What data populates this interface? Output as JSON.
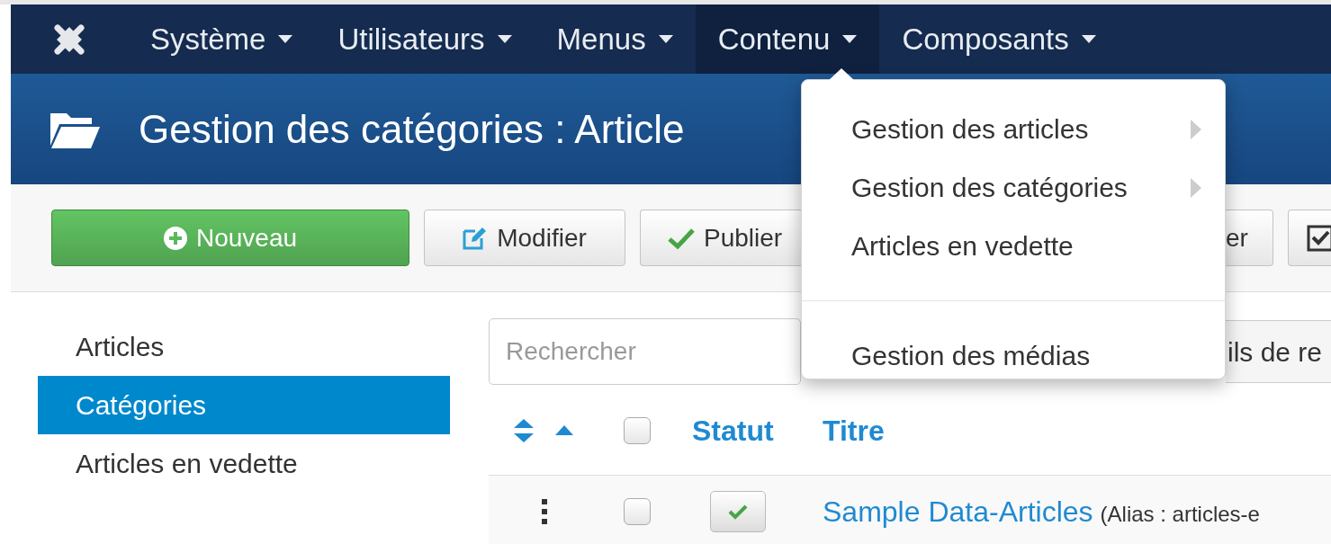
{
  "navbar": {
    "items": [
      {
        "label": "Système",
        "selected": false
      },
      {
        "label": "Utilisateurs",
        "selected": false
      },
      {
        "label": "Menus",
        "selected": false
      },
      {
        "label": "Contenu",
        "selected": true
      },
      {
        "label": "Composants",
        "selected": false
      }
    ]
  },
  "header": {
    "title": "Gestion des catégories : Article"
  },
  "toolbar": {
    "buttons": [
      {
        "label": "Nouveau",
        "kind": "primary"
      },
      {
        "label": "Modifier",
        "kind": "edit"
      },
      {
        "label": "Publier",
        "kind": "publish"
      },
      {
        "label": "er",
        "kind": "plain"
      },
      {
        "kind": "checkbox"
      }
    ]
  },
  "dropdown": {
    "items": [
      {
        "label": "Gestion des articles",
        "kind": "submenu"
      },
      {
        "label": "Gestion des catégories",
        "kind": "submenu"
      },
      {
        "label": "Articles en vedette",
        "kind": "link"
      },
      {
        "kind": "divider"
      },
      {
        "label": "Gestion des médias",
        "kind": "link"
      }
    ]
  },
  "sidebar": {
    "items": [
      {
        "label": "Articles",
        "selected": false
      },
      {
        "label": "Catégories",
        "selected": true
      },
      {
        "label": "Articles en vedette",
        "selected": false
      }
    ]
  },
  "search": {
    "placeholder": "Rechercher"
  },
  "filter_button": {
    "label": "ils de re"
  },
  "table": {
    "columns": [
      {
        "kind": "order"
      },
      {
        "kind": "checkbox",
        "checked": false
      },
      {
        "kind": "text",
        "label": "Statut"
      },
      {
        "kind": "text",
        "label": "Titre"
      }
    ],
    "rows": [
      {
        "checked": false,
        "published": true,
        "title": "Sample Data-Articles",
        "alias": "(Alias : articles-e"
      }
    ]
  }
}
